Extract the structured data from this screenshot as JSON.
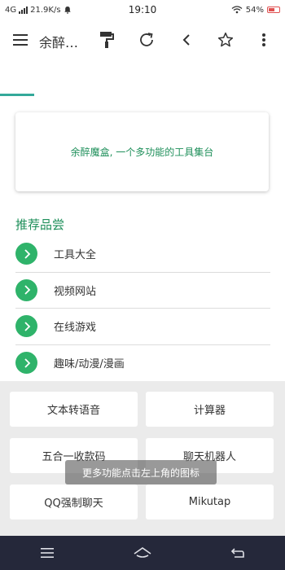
{
  "status_bar": {
    "network": "4G",
    "speed": "21.9K/s",
    "time": "19:10",
    "battery": "54%"
  },
  "toolbar": {
    "menu_icon": "hamburger-menu",
    "title": "余醉…",
    "icons": [
      "paint-roller-icon",
      "refresh-icon",
      "back-chevron-icon",
      "star-icon",
      "more-vertical-icon"
    ]
  },
  "intro_card": {
    "text": "余醉魔盒, 一个多功能的工具集台"
  },
  "recommend": {
    "title": "推荐品尝",
    "items": [
      {
        "label": "工具大全"
      },
      {
        "label": "视频网站"
      },
      {
        "label": "在线游戏"
      },
      {
        "label": "趣味/动漫/漫画"
      }
    ]
  },
  "tools": {
    "buttons": [
      {
        "label": "文本转语音"
      },
      {
        "label": "计算器"
      },
      {
        "label": "五合一收款码"
      },
      {
        "label": "聊天机器人"
      },
      {
        "label": "QQ强制聊天"
      },
      {
        "label": "Mikutap"
      }
    ]
  },
  "toast": {
    "text": "更多功能点击左上角的图标"
  },
  "nav_bar": {
    "icons": [
      "menu-icon",
      "home-icon",
      "back-icon"
    ]
  },
  "colors": {
    "accent": "#1e8f5a",
    "chevron_bg": "#2fb36a",
    "tab_indicator": "#34a99a",
    "nav_bar_bg": "#25283a"
  }
}
